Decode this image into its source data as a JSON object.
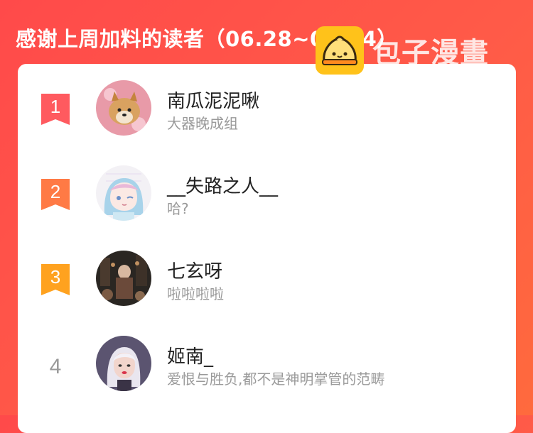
{
  "header": {
    "title": "感谢上周加料的读者（06.28~07.04）"
  },
  "watermark": {
    "text": "包子漫畫",
    "logo_icon": "steamed-bun-icon"
  },
  "readers": [
    {
      "rank": "1",
      "name": "南瓜泥泥啾",
      "subtitle": "大器晚成组",
      "badge_color": "#ff5a5f"
    },
    {
      "rank": "2",
      "name": "__失路之人__",
      "subtitle": "哈?",
      "badge_color": "#ff7a45"
    },
    {
      "rank": "3",
      "name": "七玄呀",
      "subtitle": "啦啦啦啦",
      "badge_color": "#ffa21f"
    },
    {
      "rank": "4",
      "name": "姬南_",
      "subtitle": "爱恨与胜负,都不是神明掌管的范畴"
    }
  ],
  "colors": {
    "accent": "#ff4a4a",
    "name_text": "#222222",
    "subtitle_text": "#9a9a9a"
  }
}
